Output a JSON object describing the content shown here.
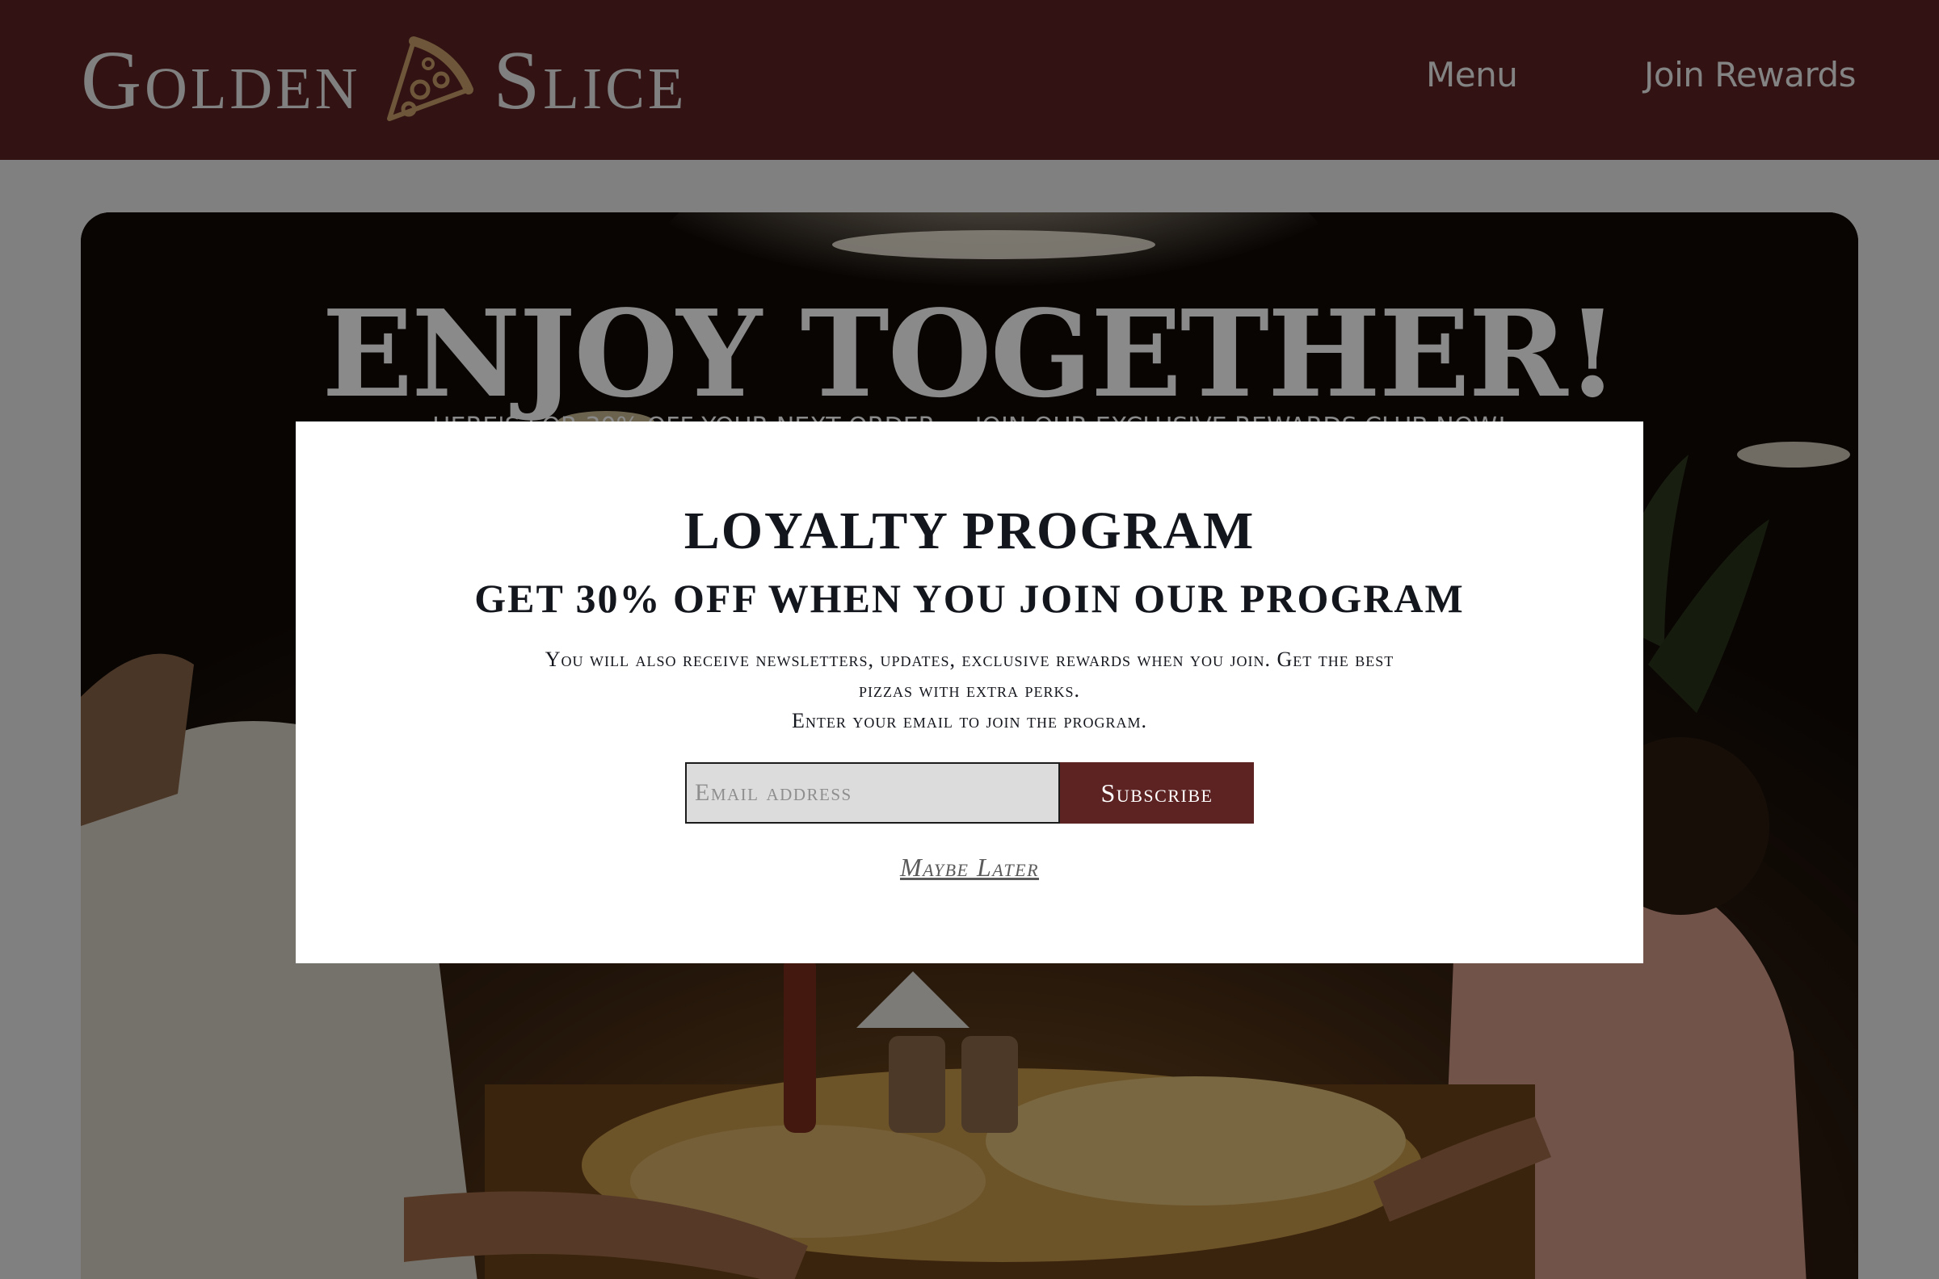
{
  "header": {
    "logo_left": "Golden",
    "logo_right": "Slice",
    "logo_icon": "pizza-slice-icon",
    "nav": {
      "menu": "Menu",
      "rewards": "Join Rewards"
    }
  },
  "hero": {
    "title": "ENJOY TOGETHER!",
    "subtitle": "HERE'S FOR 30% OFF YOUR NEXT ORDER — JOIN OUR EXCLUSIVE REWARDS CLUB NOW!"
  },
  "modal": {
    "title": "LOYALTY PROGRAM",
    "subtitle": "GET 30% OFF WHEN YOU JOIN OUR PROGRAM",
    "body_line1": "You will also receive newsletters, updates, exclusive rewards when you join. Get the best pizzas with extra perks.",
    "body_line2": "Enter your email to join the program.",
    "email_placeholder": "Email address",
    "subscribe_label": "Subscribe",
    "maybe_later_label": "Maybe Later"
  },
  "colors": {
    "brand": "#5d2222",
    "logo_gold": "#c9a06a",
    "overlay": "rgba(0,0,0,0.46)"
  }
}
